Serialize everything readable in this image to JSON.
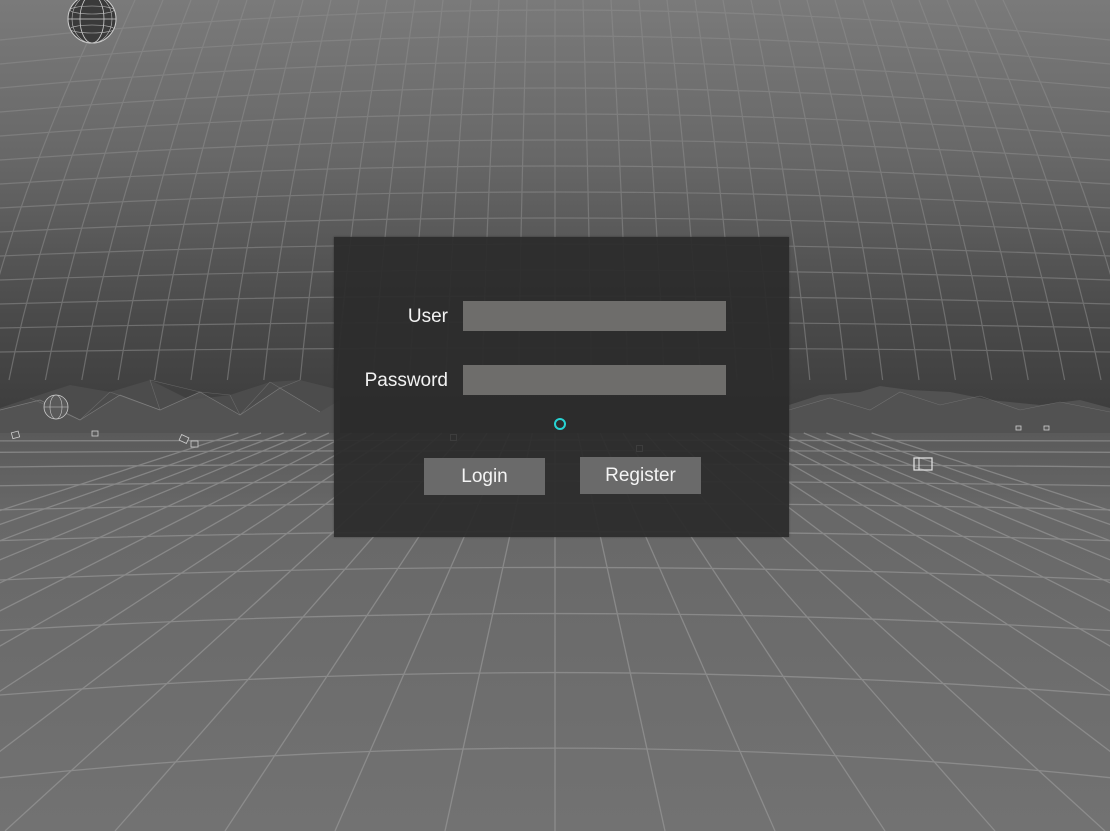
{
  "login_form": {
    "user_label": "User",
    "user_value": "",
    "password_label": "Password",
    "password_value": "",
    "login_label": "Login",
    "register_label": "Register"
  },
  "colors": {
    "panel_background": "#2c2c2c",
    "field_background": "#6e6d6b",
    "button_background": "#6a6a6a",
    "label_text": "#f2f2f2",
    "reticle": "#27d3d3",
    "sky_top": "#747474",
    "horizon": "#3e3e3e",
    "floor": "#6f6f6f",
    "grid_lines": "#9c9c9c"
  },
  "icons": {
    "reticle": "gaze-reticle-icon",
    "sphere": "wireframe-sphere-icon",
    "floating_panel": "panel-frame-icon"
  }
}
